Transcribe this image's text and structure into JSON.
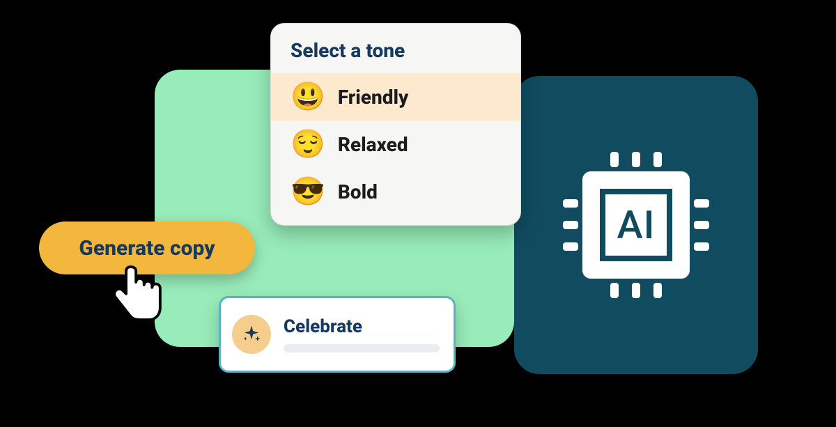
{
  "colors": {
    "brand_dark": "#163A5F",
    "accent_green": "#98ECB9",
    "accent_yellow": "#F3B73E",
    "teal_dark": "#114B5F",
    "highlight": "#FDE9CE",
    "border_blue": "#5AB2C9"
  },
  "button": {
    "generate_label": "Generate copy"
  },
  "tone_panel": {
    "title": "Select a tone",
    "items": [
      {
        "emoji": "😃",
        "label": "Friendly",
        "active": true
      },
      {
        "emoji": "😌",
        "label": "Relaxed",
        "active": false
      },
      {
        "emoji": "😎",
        "label": "Bold",
        "active": false
      }
    ]
  },
  "celebrate": {
    "title": "Celebrate"
  },
  "ai_chip": {
    "label": "AI"
  }
}
